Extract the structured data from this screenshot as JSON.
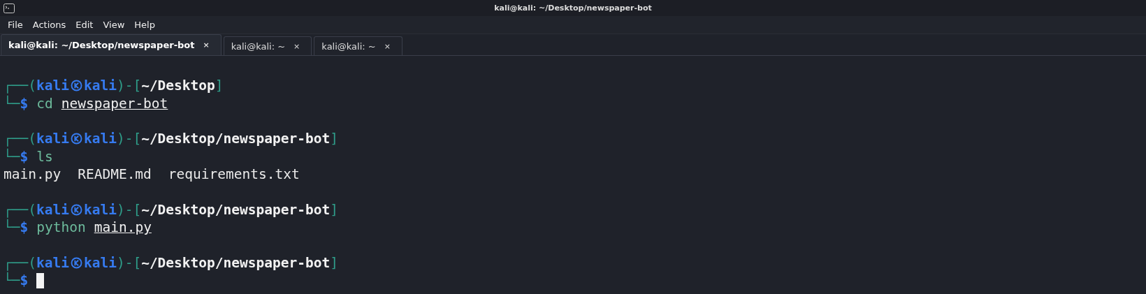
{
  "window": {
    "title": "kali@kali: ~/Desktop/newspaper-bot"
  },
  "menu": [
    "File",
    "Actions",
    "Edit",
    "View",
    "Help"
  ],
  "tabs": [
    {
      "label": "kali@kali: ~/Desktop/newspaper-bot",
      "close": "×",
      "selected": true
    },
    {
      "label": "kali@kali: ~",
      "close": "×",
      "selected": false
    },
    {
      "label": "kali@kali: ~",
      "close": "×",
      "selected": false
    }
  ],
  "terminal": {
    "blocks": [
      {
        "top": "┌──(",
        "user": "kali",
        "host": "kali",
        "mid": ")-[",
        "path": "~/Desktop",
        "end": "]",
        "bottom": "└─",
        "dollar": "$",
        "command": "cd",
        "argument": "newspaper-bot",
        "cursor": false
      },
      {
        "top": "┌──(",
        "user": "kali",
        "host": "kali",
        "mid": ")-[",
        "path": "~/Desktop/newspaper-bot",
        "end": "]",
        "bottom": "└─",
        "dollar": "$",
        "command": "ls",
        "output": [
          "main.py",
          "README.md",
          "requirements.txt"
        ],
        "cursor": false
      },
      {
        "top": "┌──(",
        "user": "kali",
        "host": "kali",
        "mid": ")-[",
        "path": "~/Desktop/newspaper-bot",
        "end": "]",
        "bottom": "└─",
        "dollar": "$",
        "command": "python",
        "argument": "main.py",
        "cursor": false
      },
      {
        "top": "┌──(",
        "user": "kali",
        "host": "kali",
        "mid": ")-[",
        "path": "~/Desktop/newspaper-bot",
        "end": "]",
        "bottom": "└─",
        "dollar": "$",
        "cursor": true
      }
    ]
  }
}
